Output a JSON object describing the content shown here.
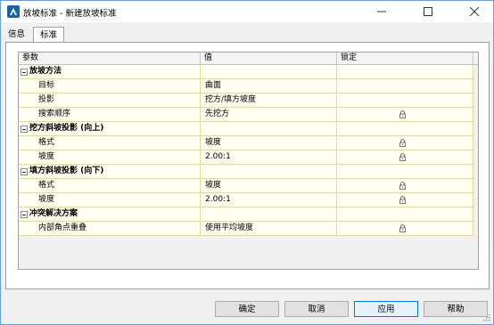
{
  "window": {
    "title": "放坡标准 - 新建放坡标准"
  },
  "tabs": [
    {
      "label": "信息"
    },
    {
      "label": "标准"
    }
  ],
  "grid": {
    "headers": {
      "param": "参数",
      "value": "值",
      "lock": "锁定"
    },
    "rows": [
      {
        "kind": "category",
        "label": "放坡方法",
        "value": ""
      },
      {
        "kind": "property",
        "label": "目标",
        "value": "曲面",
        "locked": false
      },
      {
        "kind": "property",
        "label": "投影",
        "value": "挖方/填方坡度",
        "locked": false
      },
      {
        "kind": "property",
        "label": "搜索顺序",
        "value": "先挖方",
        "locked": true
      },
      {
        "kind": "category",
        "label": "挖方斜坡投影 (向上)",
        "value": ""
      },
      {
        "kind": "property",
        "label": "格式",
        "value": "坡度",
        "locked": true
      },
      {
        "kind": "property",
        "label": "坡度",
        "value": "2.00:1",
        "locked": true
      },
      {
        "kind": "category",
        "label": "填方斜坡投影 (向下)",
        "value": ""
      },
      {
        "kind": "property",
        "label": "格式",
        "value": "坡度",
        "locked": true
      },
      {
        "kind": "property",
        "label": "坡度",
        "value": "2.00:1",
        "locked": true
      },
      {
        "kind": "category",
        "label": "冲突解决方案",
        "value": ""
      },
      {
        "kind": "property",
        "label": "内部角点重叠",
        "value": "使用平均坡度",
        "locked": true
      }
    ]
  },
  "buttons": {
    "ok": "确定",
    "cancel": "取消",
    "apply": "应用",
    "help": "帮助"
  },
  "icons": {
    "app": "autocad-civil-icon",
    "lock": "lock-icon"
  },
  "colors": {
    "row_bg": "#fffef2",
    "row_border": "#e7d79a",
    "accent": "#0078d7"
  }
}
